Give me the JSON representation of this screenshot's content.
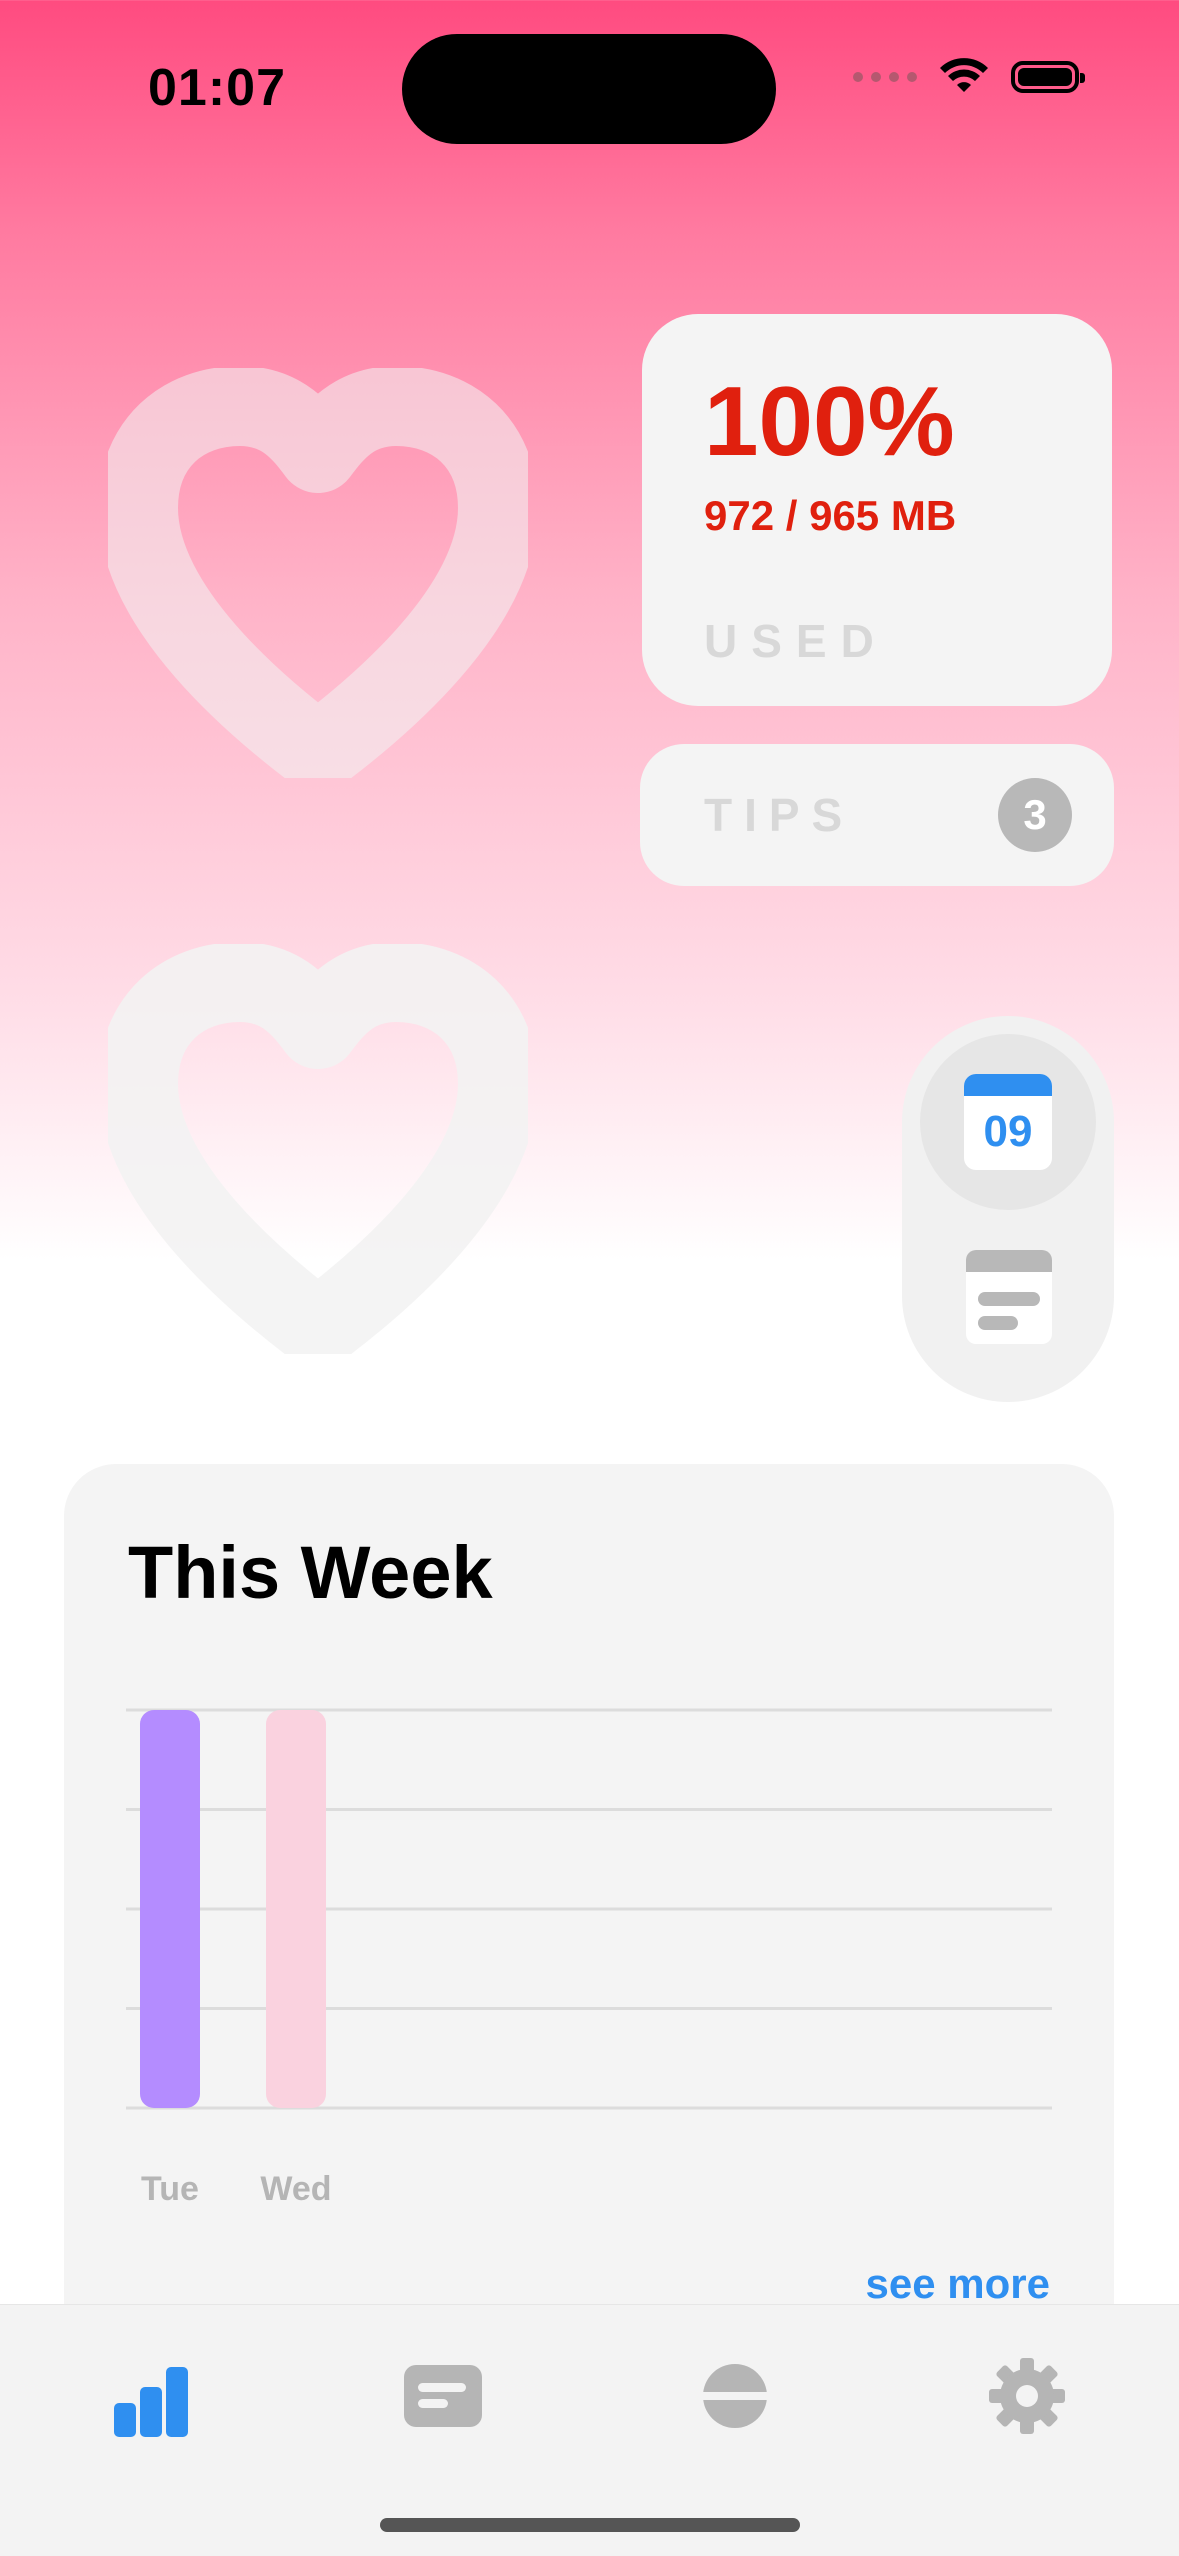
{
  "status_bar": {
    "time": "01:07"
  },
  "storage": {
    "percent": "100%",
    "usage": "972 / 965 MB",
    "label": "USED"
  },
  "tips": {
    "label": "TIPS",
    "count": "3"
  },
  "quick_actions": {
    "calendar_day": "09",
    "calendar_icon": "calendar-icon",
    "notes_icon": "notes-icon"
  },
  "week_card": {
    "title": "This Week",
    "see_more_label": "see more"
  },
  "chart_data": {
    "type": "bar",
    "categories": [
      "Tue",
      "Wed"
    ],
    "values": [
      4,
      4
    ],
    "ylim": [
      0,
      4
    ],
    "grid": true,
    "colors": [
      "#b48cff",
      "#fad2df"
    ]
  },
  "tab_bar": {
    "items": [
      {
        "icon": "bar-chart-icon",
        "active": true
      },
      {
        "icon": "notes-icon",
        "active": false
      },
      {
        "icon": "capsule-icon",
        "active": false
      },
      {
        "icon": "gear-icon",
        "active": false
      }
    ],
    "active_color": "#2f8ff0",
    "inactive_color": "#b5b5b5"
  }
}
